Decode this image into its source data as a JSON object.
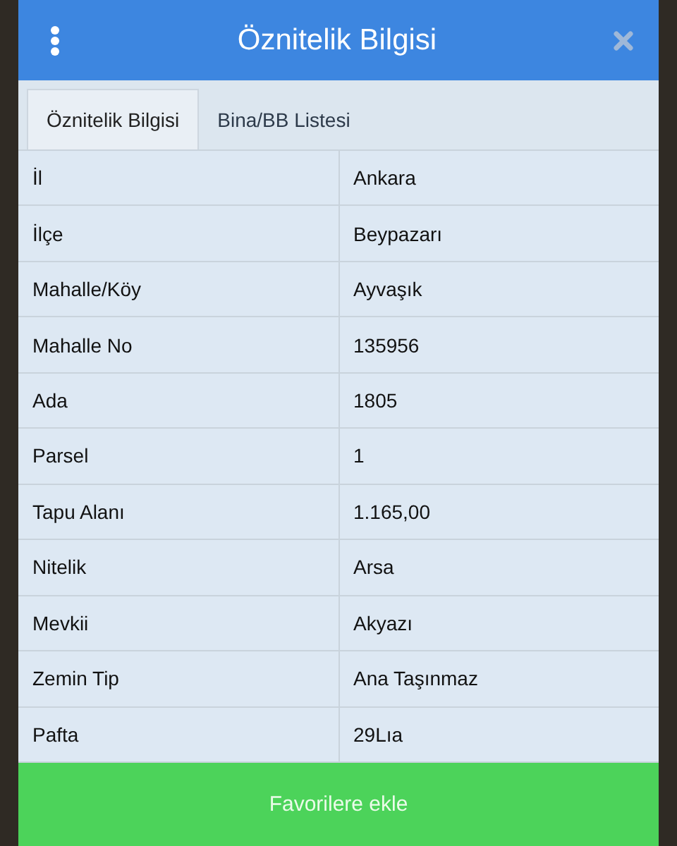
{
  "dialog": {
    "title": "Öznitelik Bilgisi"
  },
  "tabs": [
    {
      "label": "Öznitelik Bilgisi",
      "selected": true
    },
    {
      "label": "Bina/BB Listesi",
      "selected": false
    }
  ],
  "rows": [
    {
      "label": "İl",
      "value": "Ankara"
    },
    {
      "label": "İlçe",
      "value": "Beypazarı"
    },
    {
      "label": "Mahalle/Köy",
      "value": "Ayvaşık"
    },
    {
      "label": "Mahalle No",
      "value": "135956"
    },
    {
      "label": "Ada",
      "value": "1805"
    },
    {
      "label": "Parsel",
      "value": "1"
    },
    {
      "label": "Tapu Alanı",
      "value": "1.165,00"
    },
    {
      "label": "Nitelik",
      "value": "Arsa"
    },
    {
      "label": "Mevkii",
      "value": "Akyazı"
    },
    {
      "label": "Zemin Tip",
      "value": "Ana Taşınmaz"
    },
    {
      "label": "Pafta",
      "value": "29Lıa"
    }
  ],
  "button": "Favorilere ekle"
}
